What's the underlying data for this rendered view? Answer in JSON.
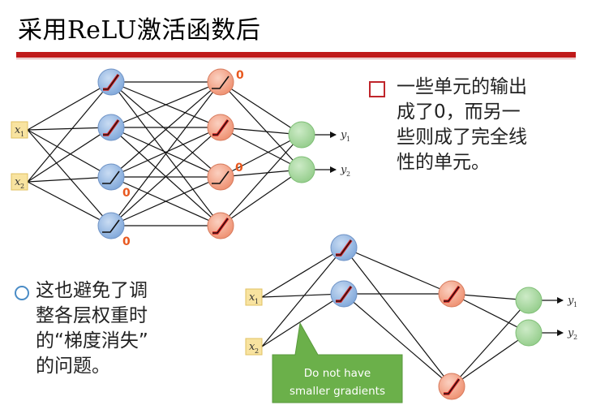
{
  "title": "采用ReLU激活函数后",
  "bullet1": {
    "lines": [
      "一些单元的输出",
      "成了0，而另一",
      "些则成了完全线",
      "性的单元。"
    ]
  },
  "bullet2": {
    "lines": [
      "这也避免了调",
      "整各层权重时",
      "的“梯度消失”",
      "的问题。"
    ]
  },
  "network_top": {
    "inputs": [
      {
        "label": "x",
        "sub": "1"
      },
      {
        "label": "x",
        "sub": "2"
      }
    ],
    "outputs": [
      {
        "label": "y",
        "sub": "1"
      },
      {
        "label": "y",
        "sub": "2"
      }
    ],
    "zero_labels": [
      "0",
      "0",
      "0",
      "0"
    ]
  },
  "network_bottom": {
    "inputs": [
      {
        "label": "x",
        "sub": "1"
      },
      {
        "label": "x",
        "sub": "2"
      }
    ],
    "outputs": [
      {
        "label": "y",
        "sub": "1"
      },
      {
        "label": "y",
        "sub": "2"
      }
    ],
    "callout_lines": [
      "Do not have",
      "smaller gradients"
    ]
  },
  "colors": {
    "accent_red": "#c01a1a",
    "blue_node": "#8fb3e0",
    "orange_node": "#f2a489",
    "green_node": "#a8d8a0",
    "callout_green": "#6bb04a",
    "zero_orange": "#e8581e",
    "input_box": "#f8e3a0"
  }
}
